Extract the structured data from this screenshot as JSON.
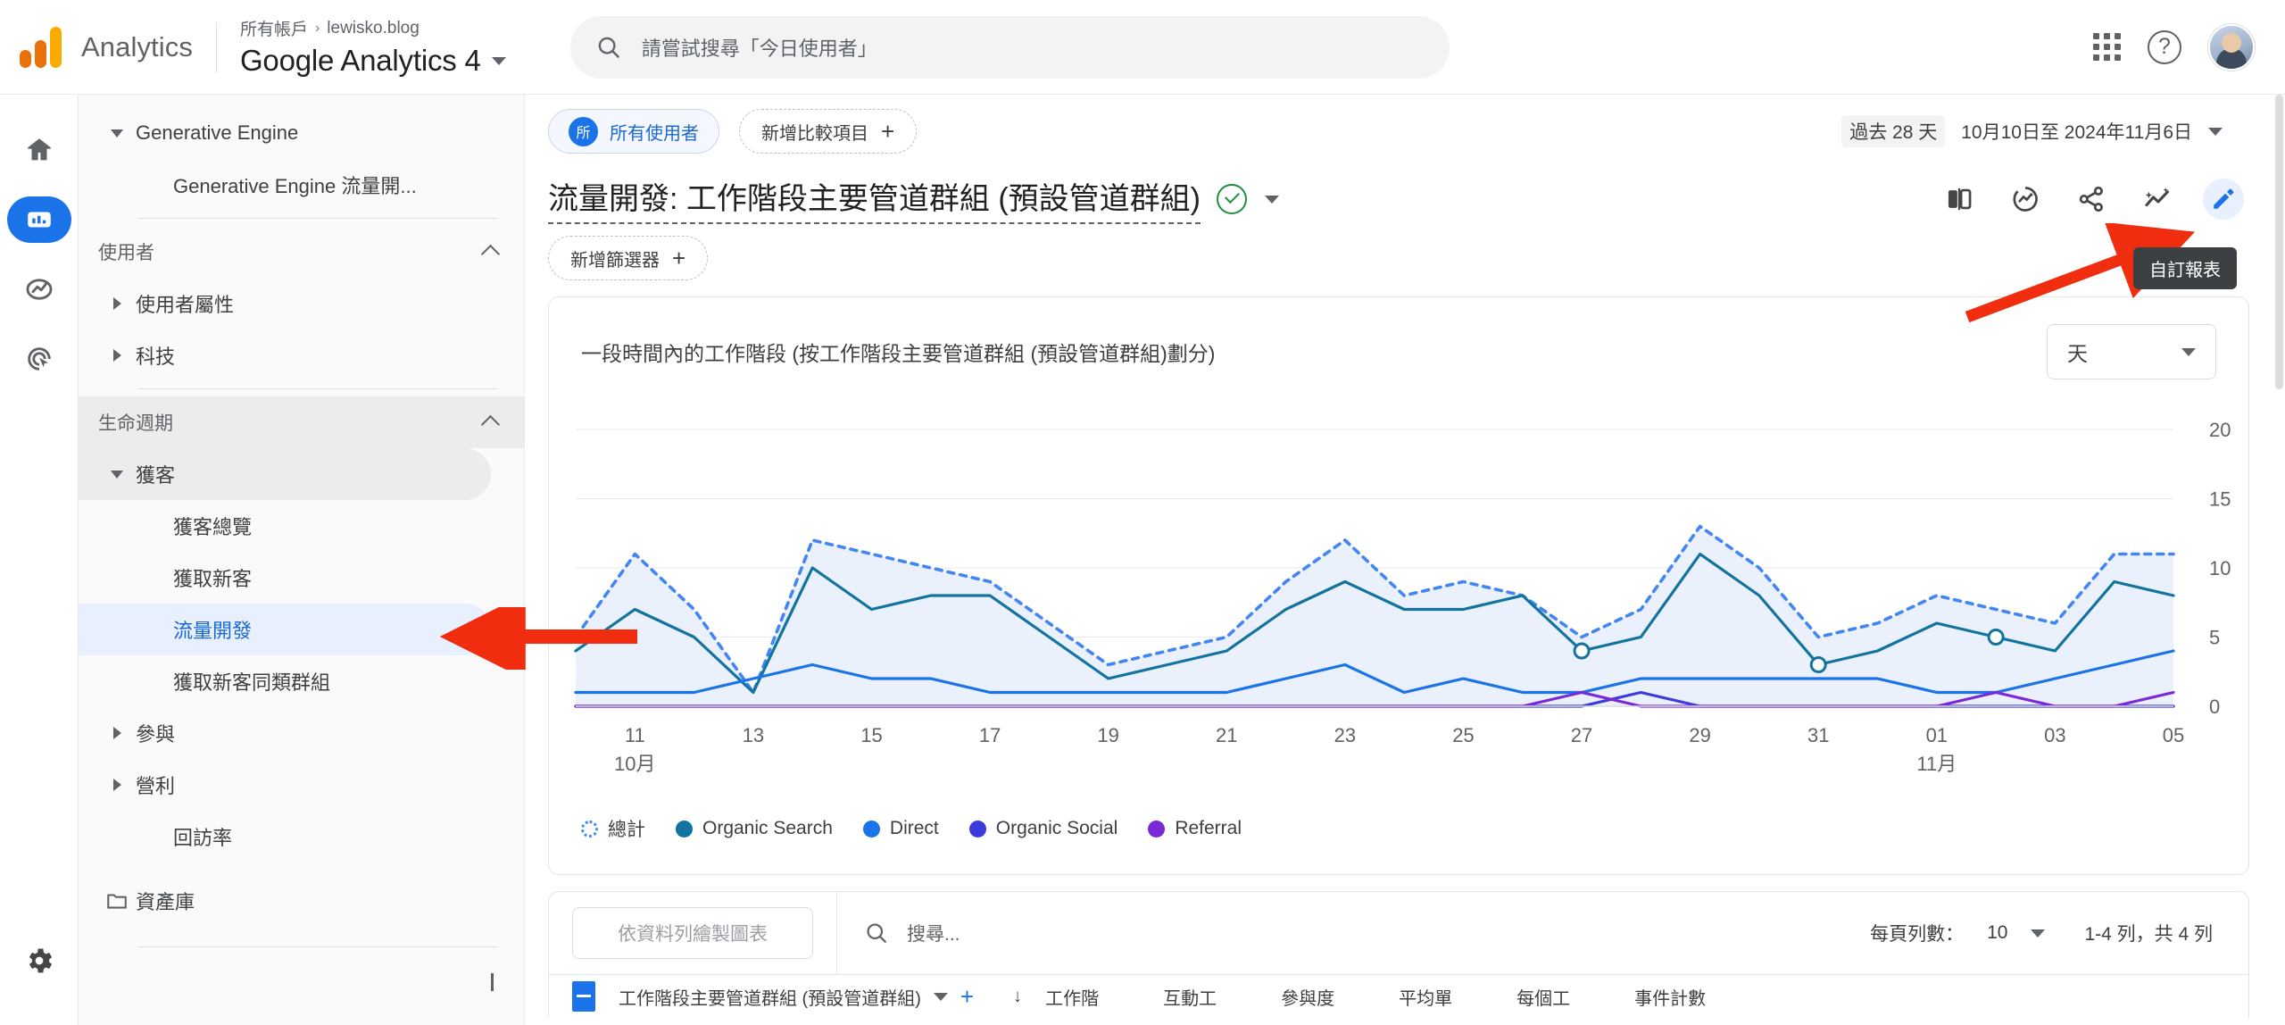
{
  "topbar": {
    "brand": "Analytics",
    "breadcrumb_account": "所有帳戶",
    "breadcrumb_sep": "›",
    "breadcrumb_property": "lewisko.blog",
    "property_name": "Google Analytics 4",
    "search_placeholder": "請嘗試搜尋「今日使用者」",
    "apps_icon": "grid-apps-icon",
    "help_icon": "help-circle-icon",
    "avatar_icon": "user-avatar"
  },
  "rail": {
    "items": [
      {
        "icon": "home-icon",
        "name": "home",
        "active": false
      },
      {
        "icon": "reports-bar-chart-icon",
        "name": "reports",
        "active": true
      },
      {
        "icon": "explore-icon",
        "name": "explore",
        "active": false
      },
      {
        "icon": "advertising-icon",
        "name": "advertising",
        "active": false
      }
    ],
    "settings_icon": "gear-icon"
  },
  "nav": {
    "items": [
      {
        "label": "Generative Engine",
        "type": "group",
        "expanded": true,
        "indent": 0
      },
      {
        "label": "Generative Engine 流量開...",
        "type": "child",
        "indent": 1
      }
    ],
    "section_users": "使用者",
    "user_items": [
      {
        "label": "使用者屬性",
        "collapsed": true
      },
      {
        "label": "科技",
        "collapsed": true
      }
    ],
    "section_lifecycle": "生命週期",
    "acquisition_label": "獲客",
    "acquisition_children": [
      {
        "label": "獲客總覽",
        "selected": false
      },
      {
        "label": "獲取新客",
        "selected": false
      },
      {
        "label": "流量開發",
        "selected": true
      },
      {
        "label": "獲取新客同類群組",
        "selected": false
      }
    ],
    "engagement_label": "參與",
    "monetization_label": "營利",
    "retention_label": "回訪率",
    "library_label": "資產庫",
    "library_icon": "folder-icon",
    "collapse_icon": "chevron-left-icon"
  },
  "controls": {
    "audience_chip": "所有使用者",
    "audience_chip_avatar": "所",
    "add_comparison": "新增比較項目",
    "add_comparison_plus": "+",
    "date_pill": "過去 28 天",
    "date_range": "10月10日至 2024年11月6日"
  },
  "report": {
    "title": "流量開發: 工作階段主要管道群組 (預設管道群組)",
    "verified_icon": "verified-check-icon",
    "title_caret_icon": "chevron-down-icon",
    "add_filter": "新增篩選器",
    "add_filter_plus": "+",
    "toolbar": [
      {
        "name": "compare-layout-icon",
        "label": "compare"
      },
      {
        "name": "insights-icon",
        "label": "insights"
      },
      {
        "name": "share-icon",
        "label": "share"
      },
      {
        "name": "sparkline-ai-icon",
        "label": "ai-trends"
      },
      {
        "name": "edit-pencil-icon",
        "label": "自訂報表"
      }
    ],
    "tooltip": "自訂報表"
  },
  "card": {
    "title": "一段時間內的工作階段 (按工作階段主要管道群組 (預設管道群組)劃分)",
    "granularity": "天",
    "granularity_caret": "chevron-down-icon"
  },
  "table_strip": {
    "plot_rows_button": "依資料列繪製圖表",
    "search_placeholder": "搜尋...",
    "search_icon": "search-icon",
    "rows_per_page_label": "每頁列數：",
    "rows_per_page_value": "10",
    "rows_per_page_caret": "chevron-down-icon",
    "range_label": "1-4 列，共 4 列",
    "dimension_header": "工作階段主要管道群組 (預設管道群組)",
    "dimension_caret": "chevron-down-icon",
    "add_dimension": "+",
    "sort_icon": "sort-down-arrow-icon",
    "columns": [
      "工作階",
      "互動工",
      "參與度",
      "平均單",
      "每個工",
      "事件計數"
    ]
  },
  "chart_data": {
    "type": "line",
    "title": "一段時間內的工作階段 (按工作階段主要管道群組 (預設管道群組)劃分)",
    "xlabel": "",
    "ylabel": "",
    "ylim": [
      0,
      20
    ],
    "yticks": [
      0,
      5,
      10,
      15,
      20
    ],
    "grid": true,
    "legend_position": "bottom-left",
    "x_tick_labels": [
      "11",
      "13",
      "15",
      "17",
      "19",
      "21",
      "23",
      "25",
      "27",
      "29",
      "31",
      "01",
      "03",
      "05"
    ],
    "x_month_labels": [
      {
        "after_tick": "11",
        "label": "10月"
      },
      {
        "after_tick": "01",
        "label": "11月"
      }
    ],
    "x": [
      "10/10",
      "10/11",
      "10/12",
      "10/13",
      "10/14",
      "10/15",
      "10/16",
      "10/17",
      "10/18",
      "10/19",
      "10/20",
      "10/21",
      "10/22",
      "10/23",
      "10/24",
      "10/25",
      "10/26",
      "10/27",
      "10/28",
      "10/29",
      "10/30",
      "10/31",
      "11/01",
      "11/02",
      "11/03",
      "11/04",
      "11/05",
      "11/06"
    ],
    "series": [
      {
        "name": "總計",
        "color": "#4285f4",
        "style": "dotted",
        "values": [
          5,
          11,
          7,
          1,
          12,
          11,
          10,
          9,
          6,
          3,
          4,
          5,
          9,
          12,
          8,
          9,
          8,
          5,
          7,
          13,
          10,
          5,
          6,
          8,
          7,
          6,
          11,
          11
        ]
      },
      {
        "name": "Organic Search",
        "color": "#11739e",
        "style": "solid",
        "values": [
          4,
          7,
          5,
          1,
          10,
          7,
          8,
          8,
          5,
          2,
          3,
          4,
          7,
          9,
          7,
          7,
          8,
          4,
          5,
          11,
          8,
          3,
          4,
          6,
          5,
          4,
          9,
          8
        ]
      },
      {
        "name": "Direct",
        "color": "#1a73e8",
        "style": "solid",
        "values": [
          1,
          1,
          1,
          2,
          3,
          2,
          2,
          1,
          1,
          1,
          1,
          1,
          2,
          3,
          1,
          2,
          1,
          1,
          2,
          2,
          2,
          2,
          2,
          1,
          1,
          2,
          3,
          4
        ]
      },
      {
        "name": "Organic Social",
        "color": "#3b3bdb",
        "style": "solid",
        "values": [
          0,
          0,
          0,
          0,
          0,
          0,
          0,
          0,
          0,
          0,
          0,
          0,
          0,
          0,
          0,
          0,
          0,
          0,
          1,
          0,
          0,
          0,
          0,
          0,
          0,
          0,
          0,
          0
        ]
      },
      {
        "name": "Referral",
        "color": "#7b29d6",
        "style": "solid",
        "values": [
          0,
          0,
          0,
          0,
          0,
          0,
          0,
          0,
          0,
          0,
          0,
          0,
          0,
          0,
          0,
          0,
          0,
          1,
          0,
          0,
          0,
          0,
          0,
          0,
          1,
          0,
          0,
          1
        ]
      }
    ],
    "legend": [
      {
        "label": "總計",
        "color": "#4285f4",
        "marker": "dotted-circle"
      },
      {
        "label": "Organic Search",
        "color": "#11739e",
        "marker": "circle"
      },
      {
        "label": "Direct",
        "color": "#1a73e8",
        "marker": "circle"
      },
      {
        "label": "Organic Social",
        "color": "#3b3bdb",
        "marker": "circle"
      },
      {
        "label": "Referral",
        "color": "#7b29d6",
        "marker": "circle"
      }
    ]
  },
  "annotations": {
    "arrow_color": "#f02d0f",
    "arrow_to_pencil": "arrow-pointing-to-edit-button",
    "arrow_to_nav": "arrow-pointing-to-traffic-acquisition"
  }
}
